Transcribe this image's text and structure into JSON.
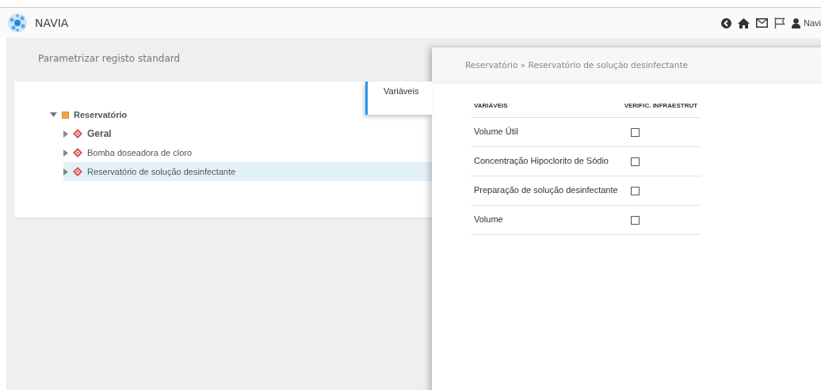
{
  "app": {
    "title": "NAVIA",
    "user": "Navi"
  },
  "page": {
    "title": "Parametrizar registo standard"
  },
  "tree": [
    {
      "label": "Reservatório",
      "kind": "group",
      "expanded": true,
      "selected": false,
      "emphasized": true,
      "children": [
        {
          "label": "Geral",
          "kind": "item",
          "expanded": false,
          "selected": false,
          "emphasized": true
        },
        {
          "label": "Bomba doseadora de cloro",
          "kind": "item",
          "expanded": false,
          "selected": false,
          "emphasized": false
        },
        {
          "label": "Reservatório de solução desinfectante",
          "kind": "item",
          "expanded": false,
          "selected": true,
          "emphasized": false
        }
      ]
    }
  ],
  "detail": {
    "breadcrumb": "Reservatório » Reservatório de solução desinfectante",
    "tabs": [
      {
        "label": "Variáveis",
        "selected": true
      }
    ],
    "table": {
      "columns": [
        "VARIÁVEIS",
        "VERIFIC. INFRAESTRUT"
      ],
      "rows": [
        {
          "name": "Volume Útil",
          "checked": false
        },
        {
          "name": "Concentração Hipoclorito de Sódio",
          "checked": false
        },
        {
          "name": "Preparação de solução desinfectante",
          "checked": false
        },
        {
          "name": "Volume",
          "checked": false
        }
      ]
    }
  }
}
